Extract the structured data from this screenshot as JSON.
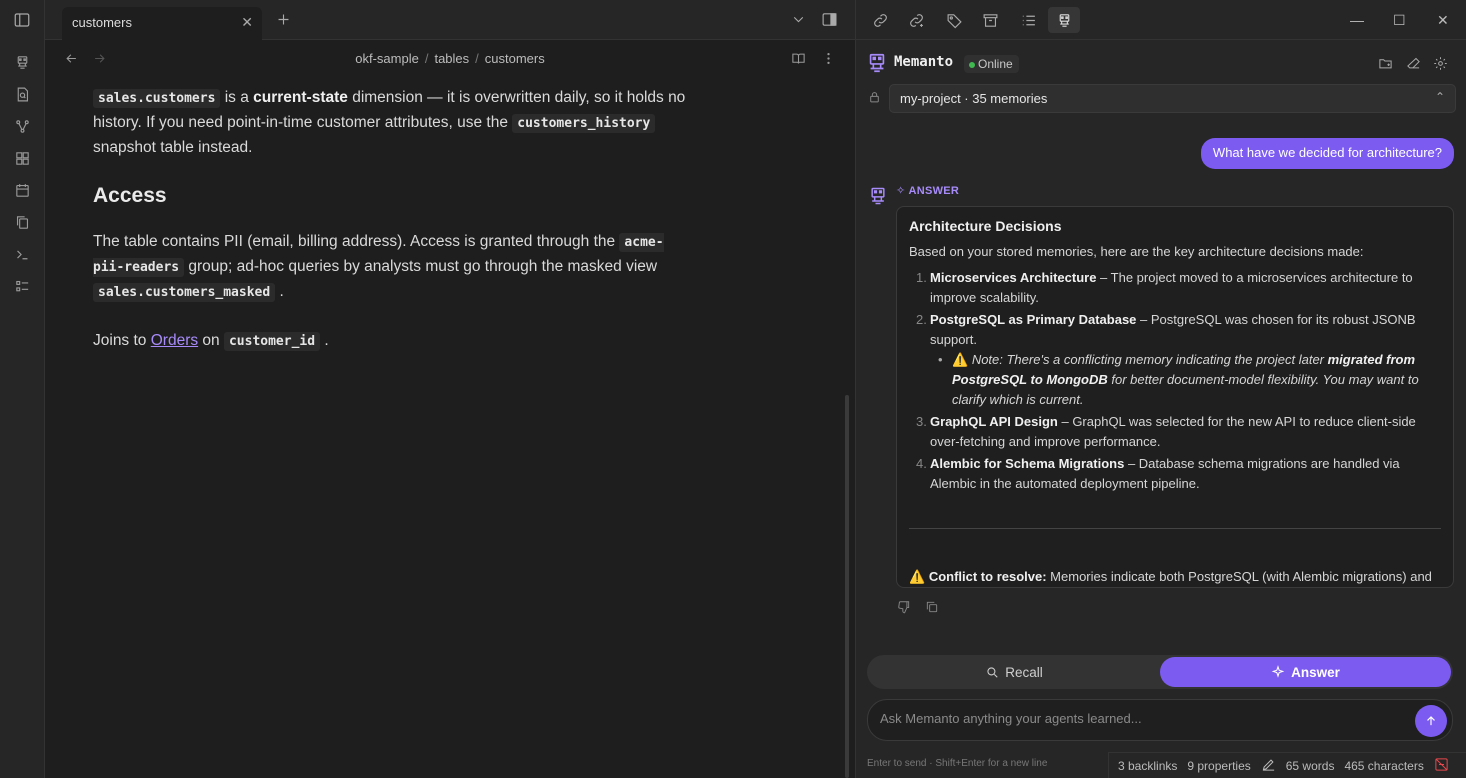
{
  "tab": {
    "title": "customers"
  },
  "breadcrumb": [
    "okf-sample",
    "tables",
    "customers"
  ],
  "doc": {
    "p1_code1": "sales.customers",
    "p1_t1": " is a ",
    "p1_bold": "current-state",
    "p1_t2": " dimension — it is overwritten daily, so it holds no history. If you need point-in-time customer attributes, use the ",
    "p1_code2": "customers_history",
    "p1_t3": " snapshot table instead.",
    "heading": "Access",
    "p2_t1": "The table contains PII (email, billing address). Access is granted through the ",
    "p2_code1": "acme-pii-readers",
    "p2_t2": " group; ad-hoc queries by analysts must go through the masked view ",
    "p2_code2": "sales.customers_masked",
    "p2_t3": " .",
    "p3_t1": "Joins to ",
    "p3_link": "Orders",
    "p3_t2": " on ",
    "p3_code": "customer_id",
    "p3_t3": " ."
  },
  "memanto": {
    "title": "Memanto",
    "status": "Online",
    "project": "my-project · 35 memories",
    "user_question": "What have we decided for architecture?",
    "answer_label": "ANSWER",
    "answer": {
      "title": "Architecture Decisions",
      "intro": "Based on your stored memories, here are the key architecture decisions made:",
      "items": [
        {
          "num": "1.",
          "bold": "Microservices Architecture",
          "text": " – The project moved to a microservices architecture to improve scalability."
        },
        {
          "num": "2.",
          "bold": "PostgreSQL as Primary Database",
          "text": " – PostgreSQL was chosen for its robust JSONB support."
        },
        {
          "num": "3.",
          "bold": "GraphQL API Design",
          "text": " – GraphQL was selected for the new API to reduce client-side over-fetching and improve performance."
        },
        {
          "num": "4.",
          "bold": "Alembic for Schema Migrations",
          "text": " – Database schema migrations are handled via Alembic in the automated deployment pipeline."
        }
      ],
      "note_t1": "Note: There's a conflicting memory indicating the project later ",
      "note_bold": "migrated from PostgreSQL to MongoDB",
      "note_t2": " for better document-model flexibility. You may want to clarify which is current.",
      "conflict_bold": "Conflict to resolve:",
      "conflict_text": " Memories indicate both PostgreSQL (with Alembic migrations) and a migration to MongoDB. It's worth confirming which database decision is the current one."
    },
    "recall_label": "Recall",
    "answer_btn_label": "Answer",
    "ask_placeholder": "Ask Memanto anything your agents learned...",
    "hint": "Enter to send · Shift+Enter for a new line"
  },
  "statusbar": {
    "backlinks": "3 backlinks",
    "properties": "9 properties",
    "words": "65 words",
    "characters": "465 characters"
  },
  "colors": {
    "accent": "#7c5bf1",
    "online": "#3fb950",
    "warning": "#f5b041",
    "link": "#a78bfa"
  }
}
